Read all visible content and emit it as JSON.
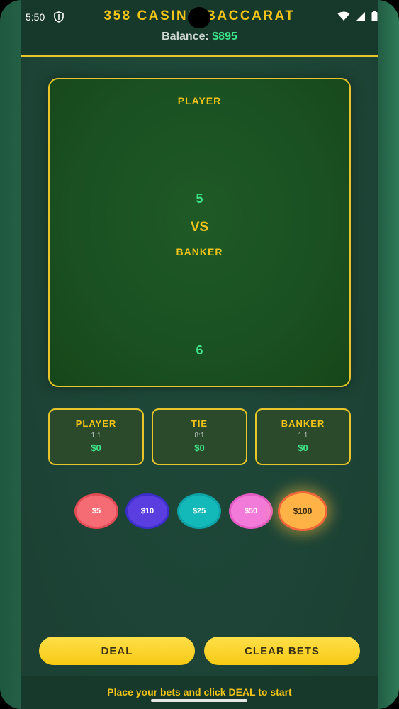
{
  "status_bar": {
    "time": "5:50"
  },
  "header": {
    "title": "358 CASINO BACCARAT",
    "balance_label": "Balance:",
    "balance_value": "$895"
  },
  "board": {
    "player_label": "PLAYER",
    "player_score": "5",
    "vs_label": "VS",
    "banker_label": "BANKER",
    "banker_score": "6"
  },
  "bets": [
    {
      "name": "PLAYER",
      "odds": "1:1",
      "amount": "$0"
    },
    {
      "name": "TIE",
      "odds": "8:1",
      "amount": "$0"
    },
    {
      "name": "BANKER",
      "odds": "1:1",
      "amount": "$0"
    }
  ],
  "chips": [
    {
      "label": "$5",
      "color": "#f56c75",
      "border": "#e34b55"
    },
    {
      "label": "$10",
      "color": "#5a3ee0",
      "border": "#3b2ec9"
    },
    {
      "label": "$25",
      "color": "#13b8b8",
      "border": "#0ea3a6"
    },
    {
      "label": "$50",
      "color": "#f27ad8",
      "border": "#e35bc3"
    },
    {
      "label": "$100",
      "color": "#ffb347",
      "border": "#f2663a"
    }
  ],
  "selected_chip": "$100",
  "buttons": {
    "deal": "DEAL",
    "clear": "CLEAR BETS"
  },
  "footer": {
    "message": "Place your bets and click DEAL to start"
  },
  "colors": {
    "accent": "#f2c318",
    "money": "#3ee68a",
    "table": "#1a5022"
  }
}
